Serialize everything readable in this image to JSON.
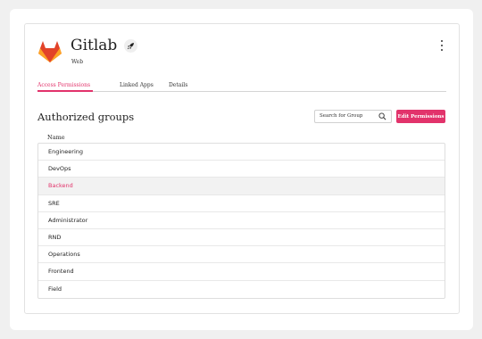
{
  "app": {
    "title": "Gitlab",
    "subtitle": "Web",
    "logo_icon": "gitlab-logo",
    "badge_icon": "rocket-icon",
    "menu_icon": "more-vertical-icon"
  },
  "tabs": [
    {
      "label": "Access Permissions",
      "active": true
    },
    {
      "label": "Linked Apps",
      "active": false
    },
    {
      "label": "Details",
      "active": false
    }
  ],
  "section": {
    "title": "Authorized groups",
    "search_placeholder": "Search for Group",
    "search_icon": "search-icon",
    "edit_button": "Edit Permissions"
  },
  "table": {
    "column": "Name",
    "rows": [
      {
        "name": "Engineering",
        "selected": false
      },
      {
        "name": "DevOps",
        "selected": false
      },
      {
        "name": "Backend",
        "selected": true
      },
      {
        "name": "SRE",
        "selected": false
      },
      {
        "name": "Administrator",
        "selected": false
      },
      {
        "name": "RND",
        "selected": false
      },
      {
        "name": "Operations",
        "selected": false
      },
      {
        "name": "Frontend",
        "selected": false
      },
      {
        "name": "Field",
        "selected": false
      }
    ]
  },
  "colors": {
    "accent": "#e2336b",
    "selected_row_bg": "#f2f2f2"
  }
}
